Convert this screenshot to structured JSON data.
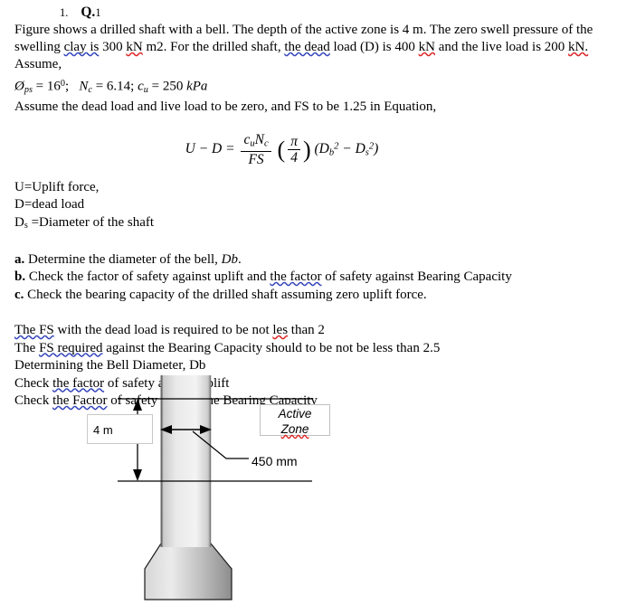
{
  "document": {
    "question_number": "1.",
    "question_label": "Q.",
    "question_index": "1",
    "paragraph": {
      "seg1": "Figure shows a drilled shaft with a bell. The depth of the active zone is 4 m. The zero swell pressure of the swelling ",
      "seg2_misspelled": "clay is",
      "seg3": " 300 ",
      "seg4_misspelled": "kN",
      "seg5": " m2. For the drilled shaft, ",
      "seg6_misspelled": "the dead",
      "seg7": " load (D) is 400 ",
      "seg8_misspelled": "kN",
      "seg9": " and the live load is 200 ",
      "seg10_misspelled": "kN.",
      "seg11": " Assume,"
    },
    "given_values": {
      "phi_symbol": "Ø",
      "phi_sub": "ps",
      "phi_value": "16",
      "phi_unit": "0",
      "nc_symbol": "N",
      "nc_sub": "c",
      "nc_value": "6.14",
      "cu_symbol": "c",
      "cu_sub": "u",
      "cu_value": "250",
      "cu_unit": "kPa",
      "sep1": "; ",
      "sep2": "; ",
      "eq": "= "
    },
    "assume_line": "Assume the dead load and live load to be zero, and FS to be 1.25 in Equation,",
    "equation": {
      "lhs": "U − D =",
      "num": "c",
      "num_sub": "u",
      "num2": "N",
      "num2_sub": "c",
      "den": "FS",
      "pi": "π",
      "four": "4",
      "rhs_open": "(D",
      "db": "b",
      "sq1": "2",
      "minus": " − D",
      "ds": "s",
      "sq2": "2",
      "rhs_close": ")"
    },
    "definitions": [
      "U=Uplift force,",
      "D=dead load",
      "Ds =Diameter of the shaft"
    ],
    "tasks": [
      {
        "letter": "a.",
        "text": " Determine the diameter of the bell, ",
        "italic": "Db",
        "tail": "."
      },
      {
        "letter": "b.",
        "text": " Check the factor of safety against uplift and ",
        "underlined": "the factor",
        "tail": " of safety against Bearing Capacity"
      },
      {
        "letter": "c.",
        "text": " Check the bearing capacity of the drilled shaft assuming zero uplift force.",
        "italic": "",
        "tail": ""
      }
    ],
    "notes": [
      {
        "pre": "",
        "underlined": "The FS",
        "post": " with the dead load is required to be not ",
        "underlined2": "les",
        "post2": " than 2"
      },
      {
        "pre": "The ",
        "underlined": "FS required",
        "post": "  against  the  Bearing Capacity should to be not be less  than 2.5",
        "underlined2": "",
        "post2": ""
      },
      {
        "pre": "Determining the Bell Diameter, Db",
        "underlined": "",
        "post": "",
        "underlined2": "",
        "post2": ""
      },
      {
        "pre": "Check ",
        "underlined": "the  factor",
        "post": " of safety against uplift",
        "underlined2": "",
        "post2": ""
      },
      {
        "pre": "Check ",
        "underlined": "the  Factor",
        "post": " of safety against  the  Bearing Capacity",
        "underlined2": "",
        "post2": ""
      }
    ]
  },
  "figure": {
    "depth_label": "4 m",
    "active_zone_line1": "Active",
    "active_zone_line2": "Zone",
    "diameter_label": "450 mm",
    "colors": {
      "shaft_light": "#f2f2f2",
      "shaft_dark": "#8a8a8a",
      "line": "#000000",
      "box_border": "#c8c8c8"
    }
  }
}
